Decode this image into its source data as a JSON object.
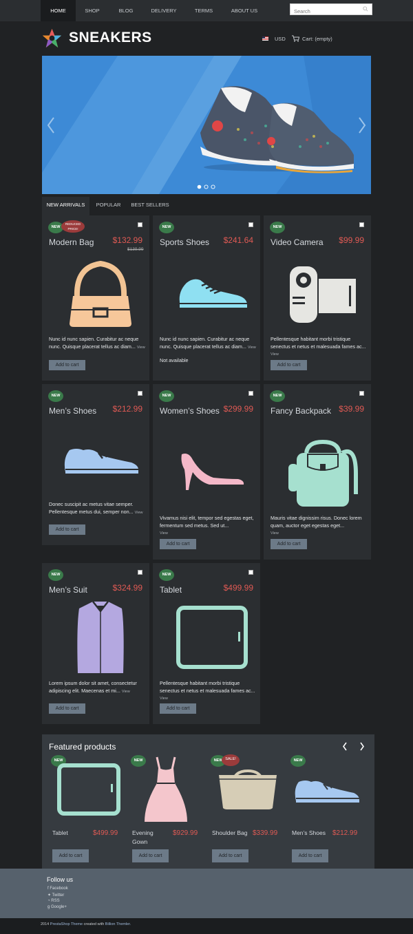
{
  "nav": {
    "items": [
      "HOME",
      "SHOP",
      "BLOG",
      "DELIVERY",
      "TERMS",
      "ABOUT US"
    ],
    "search_placeholder": "Search"
  },
  "header": {
    "brand": "SNEAKERS",
    "currency": "USD",
    "cart": "Cart: (empty)"
  },
  "banner": {
    "slide_count": 3,
    "active_slide": 1,
    "colors": {
      "sky": "#3d8ad6",
      "stripe": "#5aa0e0"
    }
  },
  "tabs": [
    "NEW ARRIVALS",
    "POPULAR",
    "BEST SELLERS"
  ],
  "badges": {
    "new": "NEW",
    "reduced": "REDUCED PRICE!",
    "sale": "SALE!"
  },
  "products": [
    {
      "name": "Modern Bag",
      "price": "$132.99",
      "old_price": "$139.99",
      "desc": "Nunc id nunc sapien. Curabitur ac neque nunc. Quisque placerat tellus ac diam...",
      "view": "View",
      "button": "Add to cart",
      "icon": "bag-icon"
    },
    {
      "name": "Sports Shoes",
      "price": "$241.64",
      "desc": "Nunc id nunc sapien. Curabitur ac neque nunc. Quisque placerat tellus ac diam...",
      "view": "View",
      "availability": "Not available",
      "icon": "sneaker-icon"
    },
    {
      "name": "Video Camera",
      "price": "$99.99",
      "desc": "Pellentesque habitant morbi tristique senectus et netus et malesuada fames ac...",
      "view": "View",
      "button": "Add to cart",
      "icon": "video-camera-icon"
    },
    {
      "name": "Men’s Shoes",
      "price": "$212.99",
      "desc": "Donec suscipit ac metus vitae semper. Pellentesque metus dui, semper non...",
      "view": "View",
      "button": "Add to cart",
      "icon": "mens-shoe-icon"
    },
    {
      "name": "Women’s Shoes",
      "price": "$299.99",
      "desc": "Vivamus nisi elit, tempor sed egestas eget, fermentum sed metus. Sed ut...",
      "view": "View",
      "button": "Add to cart",
      "icon": "high-heel-icon"
    },
    {
      "name": "Fancy Backpack",
      "price": "$39.99",
      "desc": "Mauris vitae dignissim risus. Donec lorem quam, auctor eget egestas eget...",
      "view": "View",
      "button": "Add to cart",
      "icon": "backpack-icon"
    },
    {
      "name": "Men’s Suit",
      "price": "$324.99",
      "desc": "Lorem ipsum dolor sit amet, consectetur adipiscing elit. Maecenas et mi...",
      "view": "View",
      "button": "Add to cart",
      "icon": "suit-icon"
    },
    {
      "name": "Tablet",
      "price": "$499.99",
      "desc": "Pellentesque habitant morbi tristique senectus et netus et malesuada fames ac...",
      "view": "View",
      "button": "Add to cart",
      "icon": "tablet-icon"
    }
  ],
  "featured": {
    "title": "Featured products",
    "items": [
      {
        "name": "Tablet",
        "price": "$499.99",
        "button": "Add to cart",
        "icon": "tablet-icon"
      },
      {
        "name": "Evening Gown",
        "price": "$929.99",
        "button": "Add to cart",
        "icon": "dress-icon"
      },
      {
        "name": "Shoulder Bag",
        "price": "$339.99",
        "button": "Add to cart",
        "icon": "shoulder-bag-icon"
      },
      {
        "name": "Men’s Shoes",
        "price": "$212.99",
        "button": "Add to cart",
        "icon": "mens-shoe-icon"
      }
    ]
  },
  "footer": {
    "title": "Follow us",
    "links": [
      "Facebook",
      "Twitter",
      "RSS",
      "Google+"
    ]
  },
  "copyright": {
    "year": "2014",
    "platform": "PrestaShop Theme",
    "created_with": "created with",
    "author": "Billion Themler."
  },
  "colors": {
    "background": "#202224",
    "card": "#2b2e31",
    "price": "#e05a54",
    "badge_new": "#3a7a4a",
    "badge_sale": "#9b3b3b",
    "button": "#6c7a88",
    "footer": "#56616c"
  }
}
